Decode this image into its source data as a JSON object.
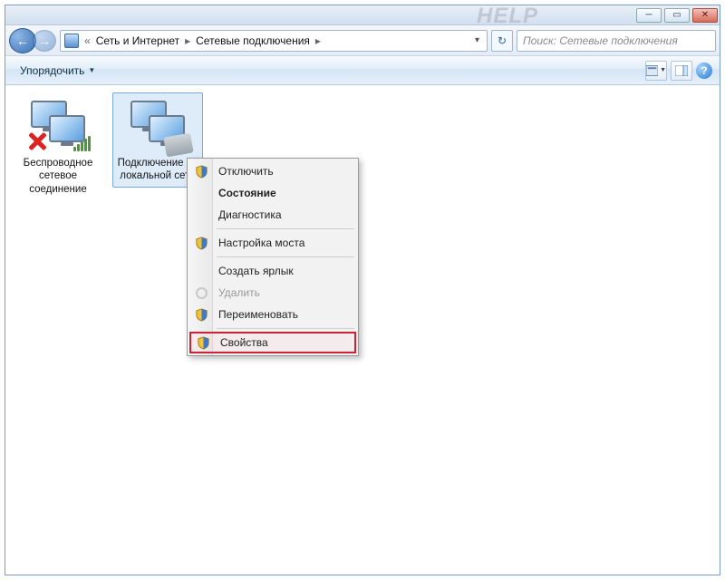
{
  "titlebar": {
    "watermark": "HELP"
  },
  "breadcrumb": {
    "items": [
      "Сеть и Интернет",
      "Сетевые подключения"
    ]
  },
  "search": {
    "placeholder": "Поиск: Сетевые подключения"
  },
  "toolbar": {
    "organize": "Упорядочить"
  },
  "connections": [
    {
      "label": "Беспроводное сетевое соединение"
    },
    {
      "label": "Подключение по локальной сети"
    }
  ],
  "contextmenu": {
    "disable": "Отключить",
    "status": "Состояние",
    "diagnose": "Диагностика",
    "bridge": "Настройка моста",
    "shortcut": "Создать ярлык",
    "delete": "Удалить",
    "rename": "Переименовать",
    "properties": "Свойства"
  }
}
